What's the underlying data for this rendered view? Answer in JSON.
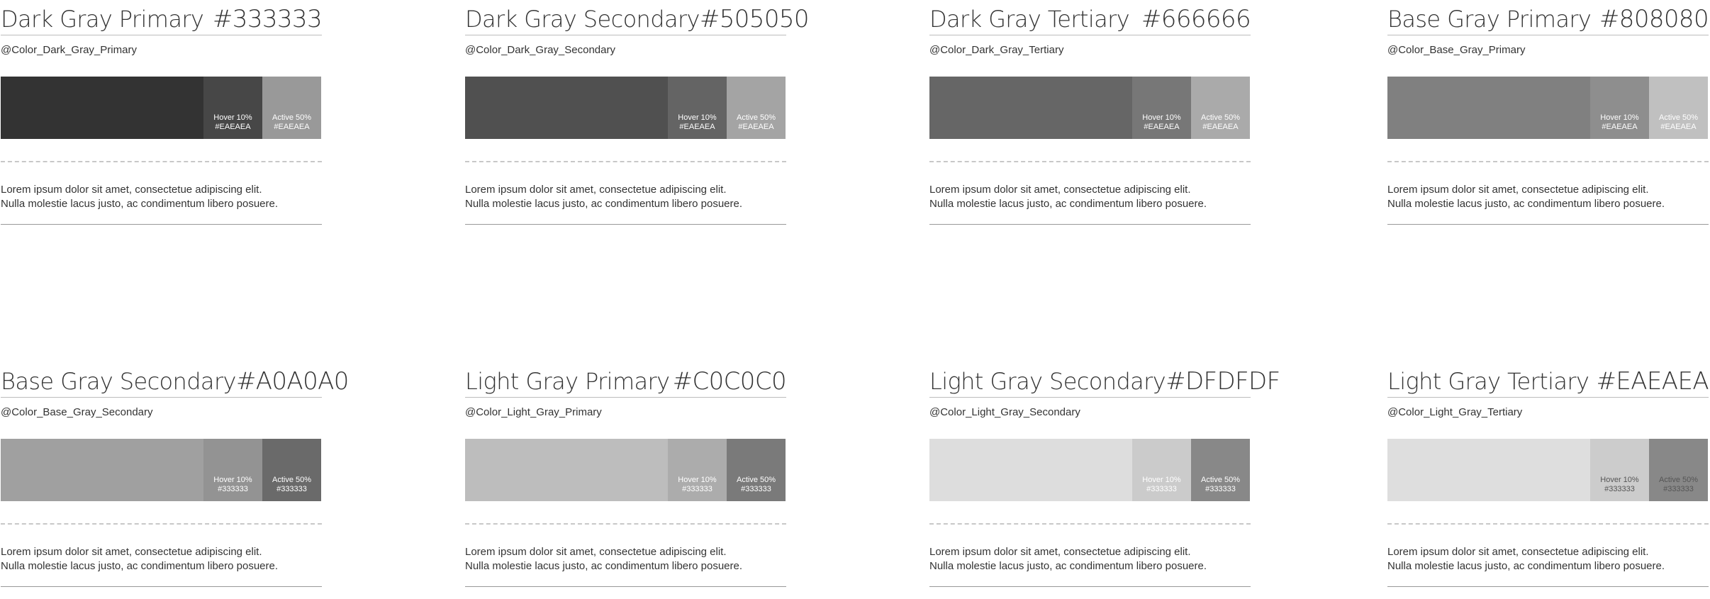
{
  "cards": [
    {
      "name": "Dark Gray Primary",
      "hex": "#333333",
      "variable": "@Color_Dark_Gray_Primary",
      "base_color": "#333333",
      "hover_label": "Hover 10%",
      "hover_value": "#EAEAEA",
      "hover_color": "#474747",
      "active_label": "Active 50%",
      "active_value": "#EAEAEA",
      "active_color": "#999999",
      "text_color": "#ffffff",
      "line1": "Lorem ipsum dolor sit amet, consectetue adipiscing elit.",
      "line2": "Nulla molestie lacus justo, ac condimentum libero posuere."
    },
    {
      "name": "Dark Gray Secondary",
      "hex": "#505050",
      "variable": "@Color_Dark_Gray_Secondary",
      "base_color": "#505050",
      "hover_label": "Hover 10%",
      "hover_value": "#EAEAEA",
      "hover_color": "#646464",
      "active_label": "Active 50%",
      "active_value": "#EAEAEA",
      "active_color": "#a4a4a4",
      "text_color": "#ffffff",
      "line1": "Lorem ipsum dolor sit amet, consectetue adipiscing elit.",
      "line2": "Nulla molestie lacus justo, ac condimentum libero posuere."
    },
    {
      "name": "Dark Gray Tertiary",
      "hex": "#666666",
      "variable": "@Color_Dark_Gray_Tertiary",
      "base_color": "#666666",
      "hover_label": "Hover 10%",
      "hover_value": "#EAEAEA",
      "hover_color": "#777777",
      "active_label": "Active 50%",
      "active_value": "#EAEAEA",
      "active_color": "#aaaaaa",
      "text_color": "#ffffff",
      "line1": "Lorem ipsum dolor sit amet, consectetue adipiscing elit.",
      "line2": "Nulla molestie lacus justo, ac condimentum libero posuere."
    },
    {
      "name": "Base Gray Primary",
      "hex": "#808080",
      "variable": "@Color_Base_Gray_Primary",
      "base_color": "#808080",
      "hover_label": "Hover 10%",
      "hover_value": "#EAEAEA",
      "hover_color": "#8e8e8e",
      "active_label": "Active 50%",
      "active_value": "#EAEAEA",
      "active_color": "#c0c0c0",
      "text_color": "#ffffff",
      "line1": "Lorem ipsum dolor sit amet, consectetue adipiscing elit.",
      "line2": "Nulla molestie lacus justo, ac condimentum libero posuere."
    },
    {
      "name": "Base Gray Secondary",
      "hex": "#A0A0A0",
      "variable": "@Color_Base_Gray_Secondary",
      "base_color": "#a0a0a0",
      "hover_label": "Hover 10%",
      "hover_value": "#333333",
      "hover_color": "#939393",
      "active_label": "Active 50%",
      "active_value": "#333333",
      "active_color": "#6a6a6a",
      "text_color": "#ffffff",
      "line1": "Lorem ipsum dolor sit amet, consectetue adipiscing elit.",
      "line2": "Nulla molestie lacus justo, ac condimentum libero posuere."
    },
    {
      "name": "Light Gray Primary",
      "hex": "#C0C0C0",
      "variable": "@Color_Light_Gray_Primary",
      "base_color": "#bdbdbd",
      "hover_label": "Hover 10%",
      "hover_value": "#333333",
      "hover_color": "#acacac",
      "active_label": "Active 50%",
      "active_value": "#333333",
      "active_color": "#7a7a7a",
      "text_color": "#ffffff",
      "line1": "Lorem ipsum dolor sit amet, consectetue adipiscing elit.",
      "line2": "Nulla molestie lacus justo, ac condimentum libero posuere."
    },
    {
      "name": "Light Gray Secondary",
      "hex": "#DFDFDF",
      "variable": "@Color_Light_Gray_Secondary",
      "base_color": "#dddddd",
      "hover_label": "Hover 10%",
      "hover_value": "#333333",
      "hover_color": "#cbcbcb",
      "active_label": "Active 50%",
      "active_value": "#333333",
      "active_color": "#888888",
      "text_color": "#ffffff",
      "line1": "Lorem ipsum dolor sit amet, consectetue adipiscing elit.",
      "line2": "Nulla molestie lacus justo, ac condimentum libero posuere."
    },
    {
      "name": "Light Gray Tertiary",
      "hex": "#EAEAEA",
      "variable": "@Color_Light_Gray_Tertiary",
      "base_color": "#dedede",
      "hover_label": "Hover 10%",
      "hover_value": "#333333",
      "hover_color": "#cccccc",
      "active_label": "Active 50%",
      "active_value": "#333333",
      "active_color": "#888888",
      "text_color": "#555555",
      "line1": "Lorem ipsum dolor sit amet, consectetue adipiscing elit.",
      "line2": "Nulla molestie lacus justo, ac condimentum libero posuere."
    }
  ]
}
